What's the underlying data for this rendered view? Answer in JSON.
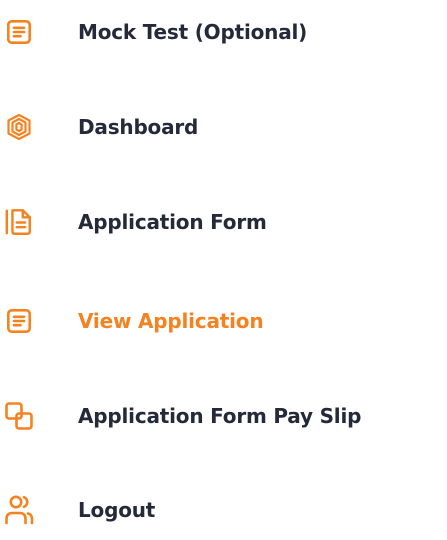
{
  "menu": {
    "items": [
      {
        "label": "Mock Test (Optional)",
        "icon": "document-list-icon",
        "active": false
      },
      {
        "label": "Dashboard",
        "icon": "dashboard-shield-icon",
        "active": false
      },
      {
        "label": "Application Form",
        "icon": "application-form-icon",
        "active": false
      },
      {
        "label": "View Application",
        "icon": "document-list-icon",
        "active": true
      },
      {
        "label": "Application Form Pay Slip",
        "icon": "pay-slip-icon",
        "active": false
      },
      {
        "label": "Logout",
        "icon": "user-logout-icon",
        "active": false
      }
    ]
  },
  "colors": {
    "accent": "#f58220",
    "text": "#242a3a",
    "background": "#ffffff"
  }
}
